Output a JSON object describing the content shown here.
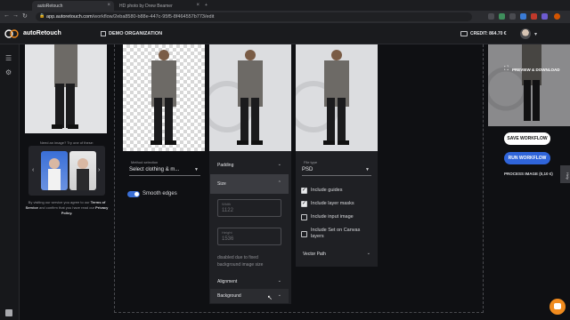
{
  "browser": {
    "tabs": [
      {
        "label": "autoRetouch"
      },
      {
        "label": "HD photo by Drew Beamer"
      }
    ],
    "url_host": "app.autoretouch.com",
    "url_path": "/workflow/2eba8580-b88e-447c-95f5-8f464557b773/edit"
  },
  "app": {
    "brand": "autoRetouch",
    "organization": "DEMO ORGANIZATION",
    "credit": "CREDIT: 864.70 €"
  },
  "left": {
    "need_image": "Need an image? Try one of these:",
    "terms_prefix": "By visiting our service you agree to our",
    "terms_link": "Terms of Service",
    "terms_mid": "and confirm that you have read our",
    "privacy_link": "Privacy Policy."
  },
  "method": {
    "label": "Method selection",
    "value": "Select clothing & m...",
    "smooth_edges": "Smooth edges"
  },
  "resize": {
    "padding": "Padding",
    "size": "Size",
    "width_label": "Width",
    "width_value": "1122",
    "height_label": "Height",
    "height_value": "1536",
    "note": "disabled due to fixed background image size",
    "alignment": "Alignment",
    "background": "Background"
  },
  "export": {
    "file_type_label": "File type",
    "file_type": "PSD",
    "options": [
      {
        "label": "Include guides",
        "checked": true
      },
      {
        "label": "Include layer masks",
        "checked": true
      },
      {
        "label": "Include input image",
        "checked": false
      },
      {
        "label": "Include Set on Canvas layers",
        "checked": false
      }
    ],
    "vector_path": "Vector Path"
  },
  "right": {
    "preview": "PREVIEW & DOWNLOAD",
    "save": "SAVE WORKFLOW",
    "run": "RUN WORKFLOW",
    "process": "PROCESS IMAGE (0,10 €)",
    "help": "Help"
  },
  "colors": {
    "accent_blue": "#2f64d9",
    "chat_orange": "#f08b1e"
  }
}
